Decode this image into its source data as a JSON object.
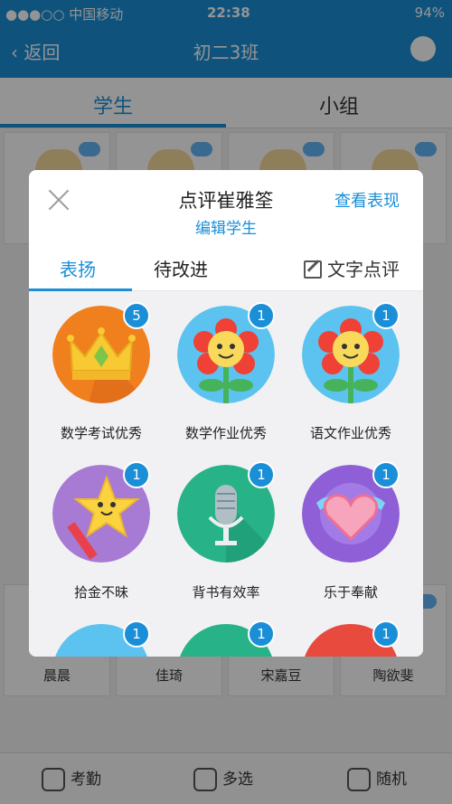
{
  "status_bar": {
    "carrier": "●●●○○ 中国移动",
    "time": "22:38",
    "battery": "94%"
  },
  "background": {
    "nav_back": "‹ 返回",
    "nav_title": "初二3班",
    "tab_students": "学生",
    "tab_groups": "小组",
    "students": [
      "晨晨",
      "佳琦",
      "宋嘉豆",
      "陶欲斐"
    ],
    "bottom_attendance": "考勤",
    "bottom_multiselect": "多选",
    "bottom_shuffle": "随机"
  },
  "modal": {
    "title": "点评崔雅筌",
    "subtitle": "编辑学生",
    "view_performance": "查看表现",
    "tab_praise": "表扬",
    "tab_improve": "待改进",
    "tab_text_comment": "文字点评"
  },
  "praise_items": [
    {
      "label": "数学考试优秀",
      "count": "5",
      "icon": "crown-icon"
    },
    {
      "label": "数学作业优秀",
      "count": "1",
      "icon": "flower-icon"
    },
    {
      "label": "语文作业优秀",
      "count": "1",
      "icon": "flower-icon"
    },
    {
      "label": "拾金不昧",
      "count": "1",
      "icon": "star-wand-icon"
    },
    {
      "label": "背书有效率",
      "count": "1",
      "icon": "microphone-icon"
    },
    {
      "label": "乐于奉献",
      "count": "1",
      "icon": "winged-heart-icon"
    },
    {
      "label": "",
      "count": "1",
      "icon": "partial-icon"
    },
    {
      "label": "",
      "count": "1",
      "icon": "partial-icon"
    },
    {
      "label": "",
      "count": "1",
      "icon": "partial-icon"
    }
  ],
  "colors": {
    "accent": "#1a8fd8",
    "overlay": "rgba(0,0,0,0.42)"
  }
}
